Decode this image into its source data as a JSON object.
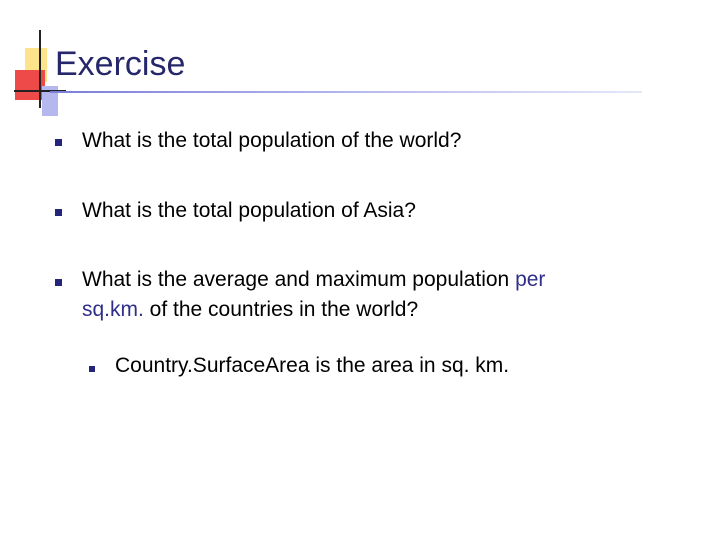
{
  "slide": {
    "title": "Exercise",
    "bullets": [
      {
        "text": "What is the total population of the world?"
      },
      {
        "text": "What is the total population of Asia?"
      },
      {
        "line1_prefix": "What is the average and maximum population ",
        "line1_highlight": "per",
        "line2_highlight": "sq.km.",
        "line2_rest": " of the countries in the world?"
      }
    ],
    "sub_bullets": [
      {
        "text": "Country.SurfaceArea is the area in sq. km."
      }
    ]
  },
  "colors": {
    "title": "#26276a",
    "bullet": "#24247a",
    "highlight": "#2f2f8a",
    "accent_yellow": "#fde38a",
    "accent_red": "#ef4a4a",
    "accent_blue": "#b5b8ee"
  }
}
